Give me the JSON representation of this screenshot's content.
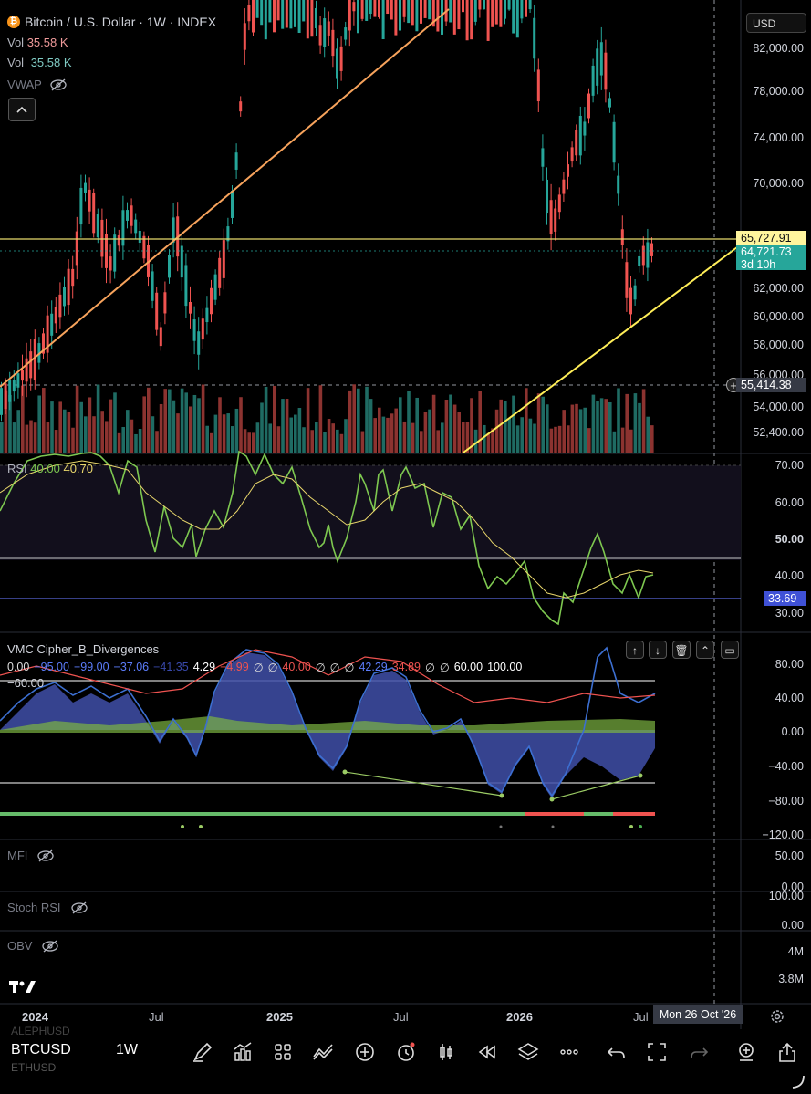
{
  "header": {
    "symbol_title": "Bitcoin / U.S. Dollar · 1W · INDEX",
    "vol1_label": "Vol",
    "vol1_value": "35.58 K",
    "vol2_label": "Vol",
    "vol2_value": "35.58 K",
    "vwap_label": "VWAP",
    "currency": "USD"
  },
  "price_axis": {
    "labels": [
      "82,000.00",
      "78,000.00",
      "74,000.00",
      "70,000.00",
      "62,000.00",
      "60,000.00",
      "58,000.00",
      "56,000.00",
      "54,000.00",
      "52,400.00"
    ],
    "tag_high": "65,727.91",
    "tag_last": "64,721.73",
    "tag_countdown": "3d 10h",
    "tag_crosshair": "55,414.38"
  },
  "rsi": {
    "label": "RSI",
    "value1": "40.00",
    "value2": "40.70",
    "axis": [
      "70.00",
      "60.00",
      "50.00",
      "40.00",
      "30.00"
    ],
    "tag": "33.69"
  },
  "vmc": {
    "label": "VMC Cipher_B_Divergences",
    "values_row1": [
      "0.00",
      "−95.00",
      "−99.00",
      "−37.06",
      "−41.35",
      "4.29",
      "−4.99",
      "∅",
      "∅",
      "40.00",
      "∅",
      "∅",
      "∅",
      "42.29",
      "34.89",
      "∅",
      "∅",
      "60.00",
      "100.00"
    ],
    "values_row2": "−60.00",
    "axis": [
      "80.00",
      "40.00",
      "0.00",
      "−40.00",
      "−80.00",
      "−120.00"
    ]
  },
  "mfi": {
    "label": "MFI",
    "axis": [
      "50.00",
      "0.00"
    ]
  },
  "stoch": {
    "label": "Stoch RSI",
    "axis": [
      "100.00",
      "0.00"
    ]
  },
  "obv": {
    "label": "OBV",
    "axis": [
      "4M",
      "3.8M"
    ]
  },
  "time_axis": {
    "labels": [
      "2024",
      "Jul",
      "2025",
      "Jul",
      "2026",
      "Jul"
    ],
    "crosshair_date": "Mon 26 Oct '26"
  },
  "bottom": {
    "symbol": "BTCUSD",
    "symbol_above": "ALEPHUSD",
    "symbol_below": "ETHUSD",
    "interval": "1W"
  },
  "colors": {
    "up": "#26a69a",
    "down": "#ef5350",
    "yellow_line": "#ffeb3b",
    "orange_line": "#f7a35c",
    "rsi_line": "#7ec850",
    "rsi_ma": "#e8d66b",
    "wave_fill": "#3f4fa8"
  },
  "icons": [
    "bitcoin-icon",
    "eye-off-icon",
    "chevron-up-icon",
    "plus-circle-icon",
    "settings-icon",
    "draw-icon",
    "indicators-icon",
    "grid-icon",
    "compare-icon",
    "add-icon",
    "alert-icon",
    "chart-type-icon",
    "replay-icon",
    "layers-icon",
    "more-icon",
    "undo-icon",
    "fullscreen-icon",
    "redo-icon",
    "watchlist-icon",
    "share-icon"
  ]
}
